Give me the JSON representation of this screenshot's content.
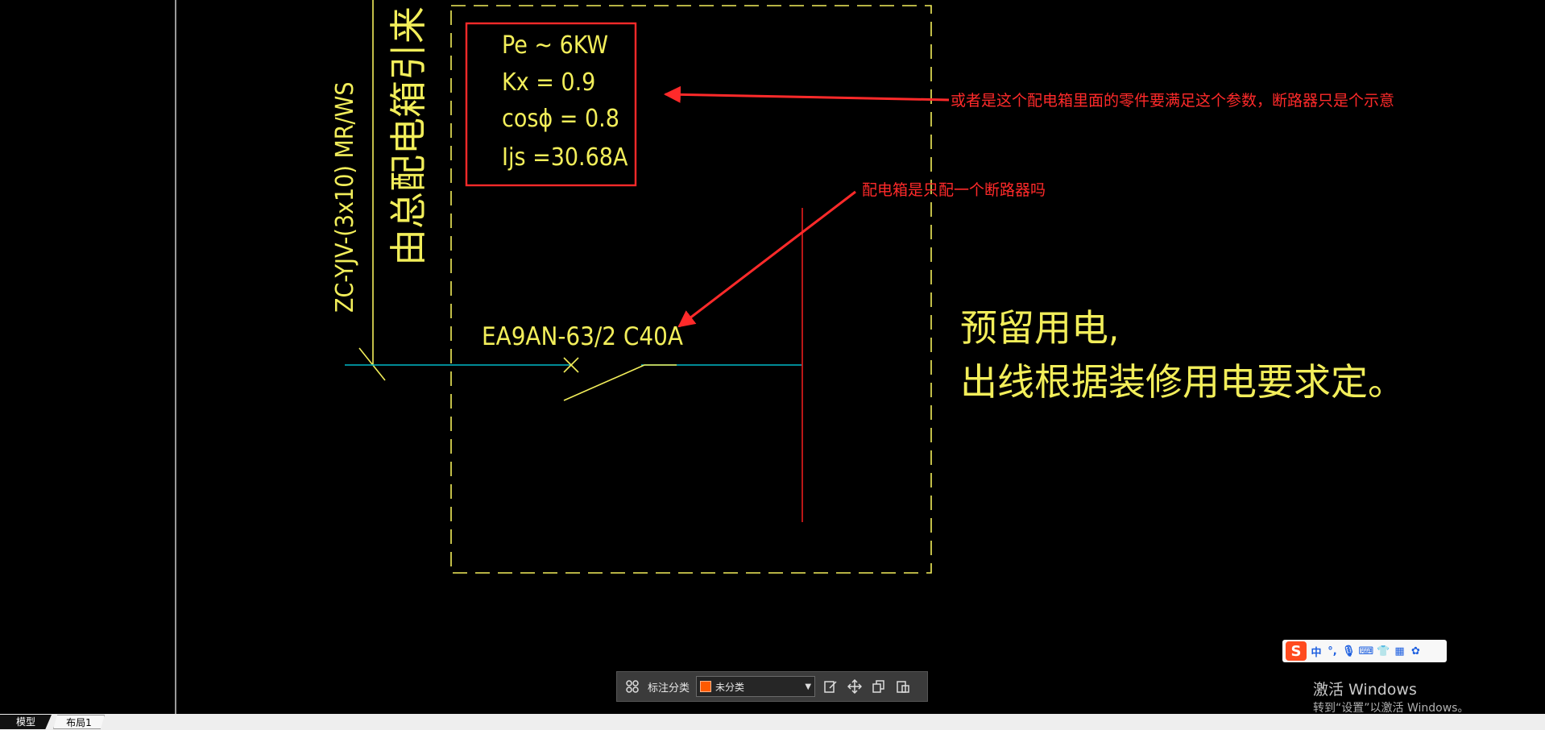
{
  "drawing": {
    "cable_label": "ZC-YJV-(3x10) MR/WS",
    "source_label": "由总配电箱引来",
    "params": {
      "pe": "Pe ~ 6KW",
      "kx": "Kx = 0.9",
      "cos": "cosϕ = 0.8",
      "ijs": "Ijs =30.68A"
    },
    "breaker_label": "EA9AN-63/2 C40A",
    "reserved_line1": "预留用电,",
    "reserved_line2": "出线根据装修用电要求定。"
  },
  "annotations": {
    "note1": "或者是这个配电箱里面的零件要满足这个参数，断路器只是个示意",
    "note2": "配电箱是只配一个断路器吗"
  },
  "toolbar": {
    "category_label": "标注分类",
    "category_value": "未分类",
    "category_color": "#ff5a00"
  },
  "ime": {
    "logo": "S",
    "mode": "中"
  },
  "watermark": {
    "title": "激活 Windows",
    "subtitle": "转到“设置”以激活 Windows。"
  },
  "tabs": {
    "model": "模型",
    "layout1": "布局1"
  },
  "colors": {
    "cad_yellow": "#f2ee5a",
    "markup_red": "#ff2a2a",
    "wire_cyan": "#00b8c8",
    "busbar_red": "#d01818"
  }
}
